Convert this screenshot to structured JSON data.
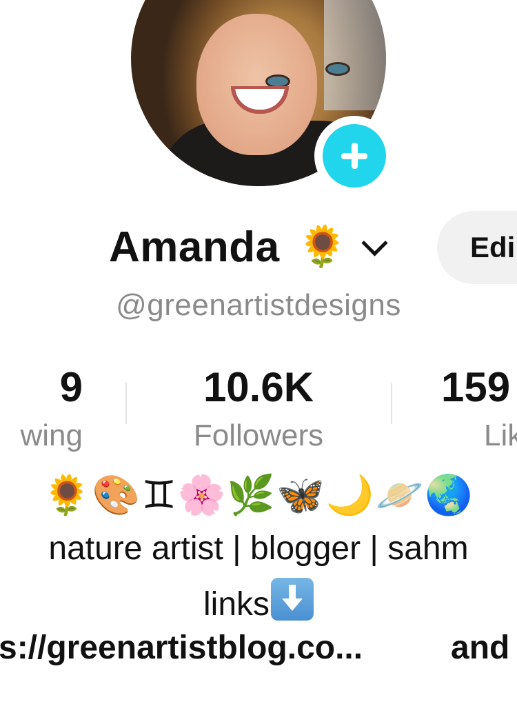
{
  "profile": {
    "name": "Amanda",
    "name_emoji": "🌻",
    "username": "@greenartistdesigns",
    "edit_button_label": "Edi"
  },
  "stats": {
    "following": {
      "value": "9",
      "label": "wing"
    },
    "followers": {
      "value": "10.6K",
      "label": "Followers"
    },
    "likes": {
      "value": "159",
      "label": "Lik"
    }
  },
  "bio": {
    "emojis": "🌻🎨♊🌸🌿🦋🌙🪐🌏",
    "line1": "nature artist | blogger | sahm",
    "line2": "links",
    "link_text": "s://greenartistblog.co...",
    "link_suffix": "and"
  },
  "icons": {
    "add_button": "plus-icon",
    "dropdown": "chevron-down-icon",
    "links_arrow": "down-arrow-icon"
  },
  "colors": {
    "accent_cyan": "#20d5ec",
    "muted_text": "#8a8a8a",
    "button_bg": "#f1f1f2"
  }
}
